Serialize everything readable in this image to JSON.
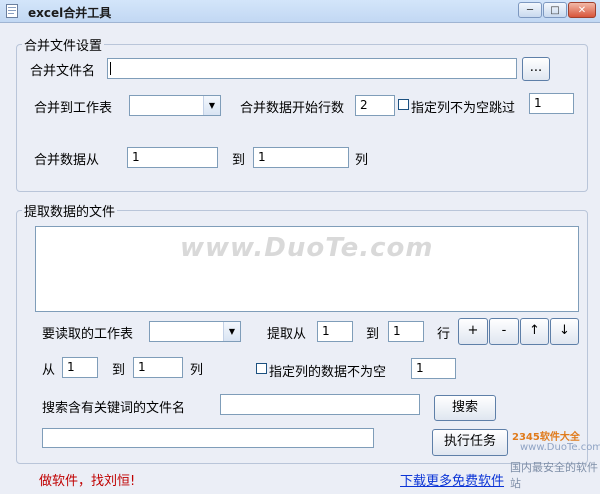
{
  "window": {
    "title": "excel合并工具",
    "controls": {
      "minimize": "─",
      "maximize": "□",
      "close": "✕"
    }
  },
  "merge_settings": {
    "legend": "合并文件设置",
    "file_label": "合并文件名",
    "file_value": "",
    "browse_label": "...",
    "sheet_label": "合并到工作表",
    "sheet_value": "",
    "start_row_label": "合并数据开始行数",
    "start_row_value": "2",
    "skip_checkbox_label": "指定列不为空跳过",
    "skip_checked": false,
    "skip_value": "1",
    "from_label": "合并数据从",
    "from_value": "1",
    "to_label": "到",
    "to_value": "1",
    "col_label": "列"
  },
  "extract": {
    "legend": "提取数据的文件",
    "watermark": "www.DuoTe.com",
    "sheet_label": "要读取的工作表",
    "sheet_value": "",
    "extract_from_label": "提取从",
    "extract_from_value": "1",
    "extract_to_label": "到",
    "extract_to_value": "1",
    "row_label": "行",
    "buttons": {
      "add": "+",
      "remove": "-",
      "up": "↑",
      "down": "↓"
    },
    "from_label": "从",
    "from_value": "1",
    "to_label": "到",
    "to_value": "1",
    "col_label": "列",
    "nonempty_checkbox_label": "指定列的数据不为空",
    "nonempty_checked": false,
    "nonempty_value": "1",
    "search_label": "搜索含有关键词的文件名",
    "search_value": "",
    "search_button": "搜索",
    "status_value": "",
    "run_button": "执行任务"
  },
  "footer": {
    "left_link": "做软件，找刘恒!",
    "right_link": "下载更多免费软件"
  },
  "corner_watermark": {
    "line1": "2345软件大全",
    "line2": "www.DuoTe.com",
    "line3": "国内最安全的软件站"
  }
}
